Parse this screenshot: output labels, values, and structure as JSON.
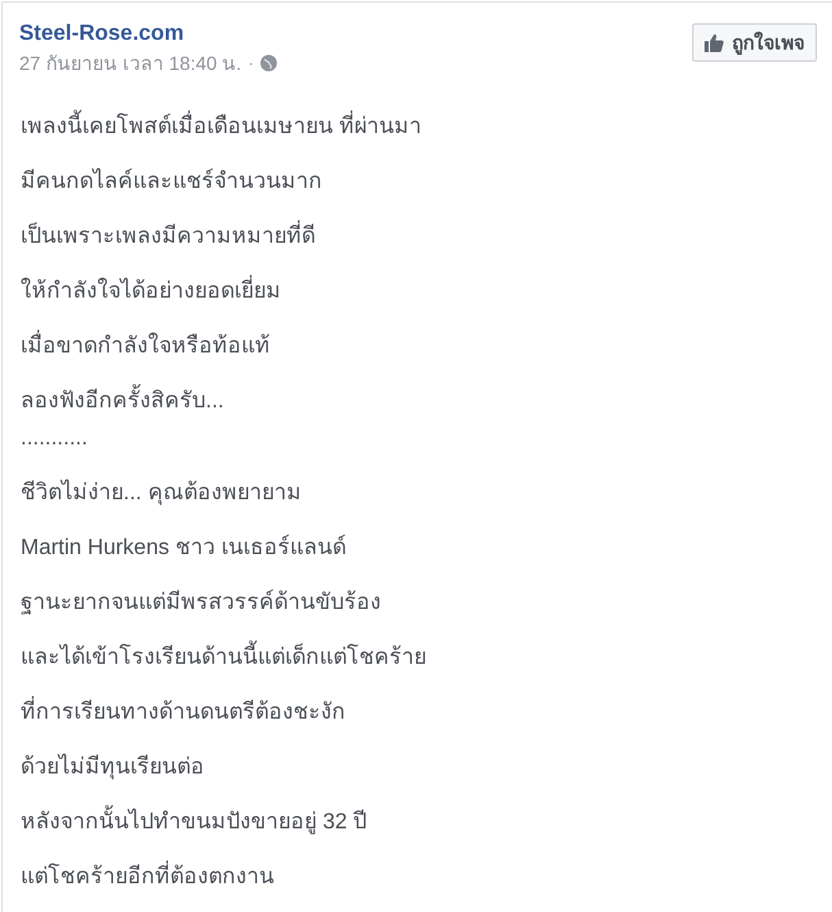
{
  "post": {
    "page_name": "Steel-Rose.com",
    "timestamp": "27 กันยายน เวลา 18:40 น.",
    "separator": "·",
    "like_button": "ถูกใจเพจ"
  },
  "paragraphs": [
    {
      "lines": [
        "เพลงนี้เคยโพสต์เมื่อเดือนเมษายน ที่ผ่านมา"
      ]
    },
    {
      "lines": [
        "มีคนกดไลค์และแชร์จำนวนมาก"
      ]
    },
    {
      "lines": [
        "เป็นเพราะเพลงมีความหมายที่ดี"
      ]
    },
    {
      "lines": [
        "ให้กำลังใจได้อย่างยอดเยี่ยม"
      ]
    },
    {
      "lines": [
        "เมื่อขาดกำลังใจหรือท้อแท้"
      ]
    },
    {
      "lines": [
        "ลองฟังอีกครั้งสิครับ...",
        "..........."
      ]
    },
    {
      "lines": [
        "ชีวิตไม่ง่าย... คุณต้องพยายาม"
      ]
    },
    {
      "lines": [
        "Martin Hurkens ชาว เนเธอร์แลนด์"
      ]
    },
    {
      "lines": [
        "ฐานะยากจนแต่มีพรสวรรค์ด้านขับร้อง"
      ]
    },
    {
      "lines": [
        "และได้เข้าโรงเรียนด้านนี้แต่เด็กแต่โชคร้าย"
      ]
    },
    {
      "lines": [
        "ที่การเรียนทางด้านดนตรีต้องชะงัก"
      ]
    },
    {
      "lines": [
        "ด้วยไม่มีทุนเรียนต่อ"
      ]
    },
    {
      "lines": [
        "หลังจากนั้นไปทำขนมปังขายอยู่ 32 ปี"
      ]
    },
    {
      "lines": [
        "แต่โชคร้ายอีกที่ต้องตกงาน"
      ]
    }
  ]
}
